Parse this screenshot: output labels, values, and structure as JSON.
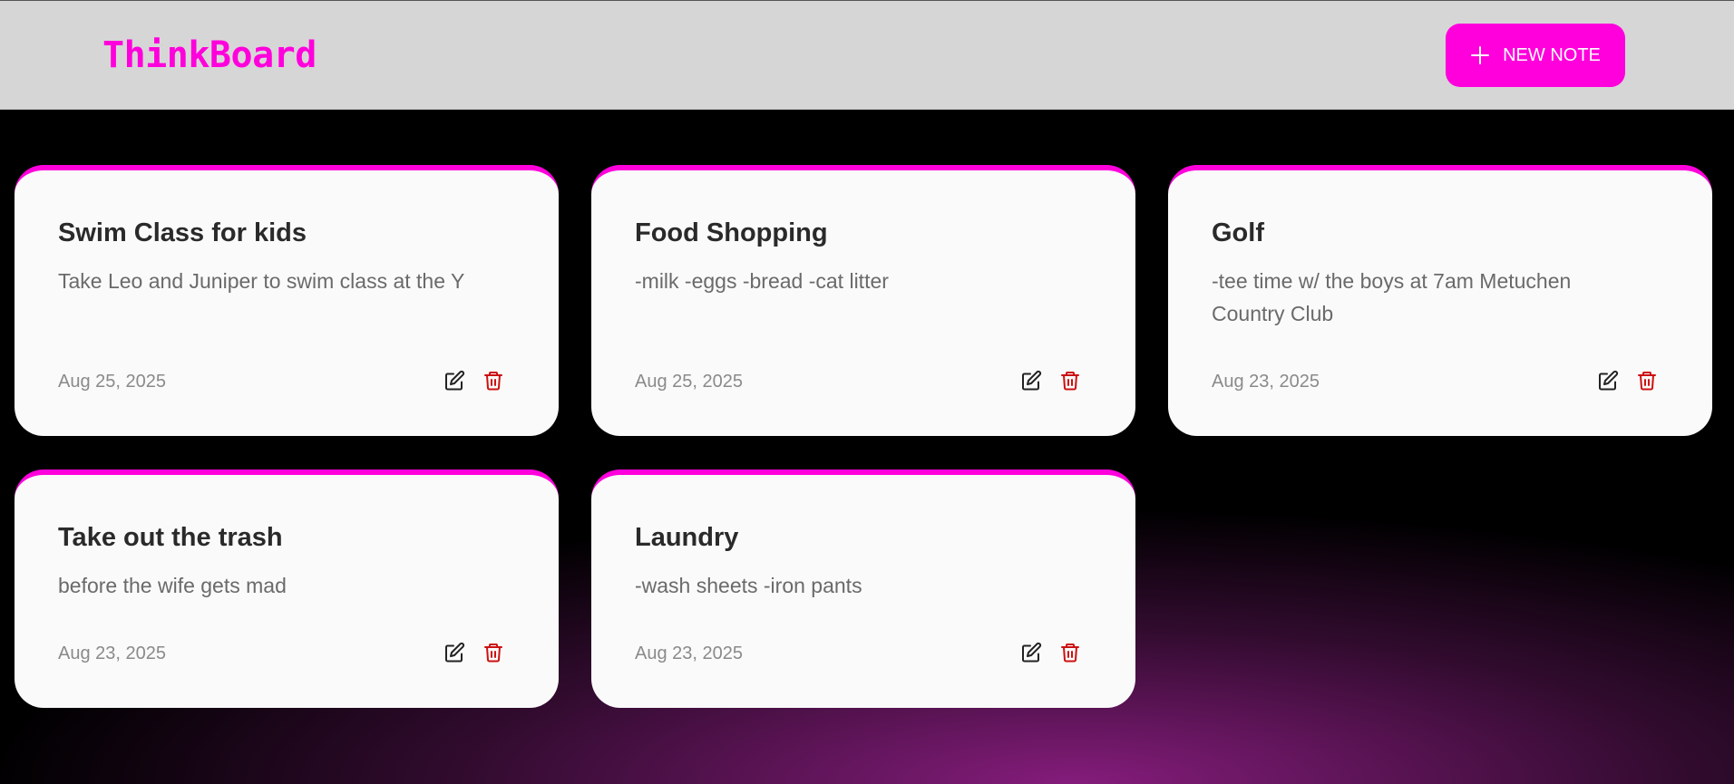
{
  "app": {
    "title": "ThinkBoard",
    "accent_color": "#ff00dd",
    "danger_color": "#cc1111"
  },
  "header": {
    "new_note_label": "NEW NOTE",
    "new_note_icon": "plus-icon"
  },
  "notes": [
    {
      "title": "Swim Class for kids",
      "content": "Take Leo and Juniper to swim class at the Y",
      "date": "Aug 25, 2025",
      "edit_icon": "edit-icon",
      "delete_icon": "trash-icon"
    },
    {
      "title": "Food Shopping",
      "content": "-milk -eggs -bread -cat litter",
      "date": "Aug 25, 2025",
      "edit_icon": "edit-icon",
      "delete_icon": "trash-icon"
    },
    {
      "title": "Golf",
      "content": "-tee time w/ the boys at 7am Metuchen Country Club",
      "date": "Aug 23, 2025",
      "edit_icon": "edit-icon",
      "delete_icon": "trash-icon"
    },
    {
      "title": "Take out the trash",
      "content": "before the wife gets mad",
      "date": "Aug 23, 2025",
      "edit_icon": "edit-icon",
      "delete_icon": "trash-icon"
    },
    {
      "title": "Laundry",
      "content": "-wash sheets -iron pants",
      "date": "Aug 23, 2025",
      "edit_icon": "edit-icon",
      "delete_icon": "trash-icon"
    }
  ]
}
